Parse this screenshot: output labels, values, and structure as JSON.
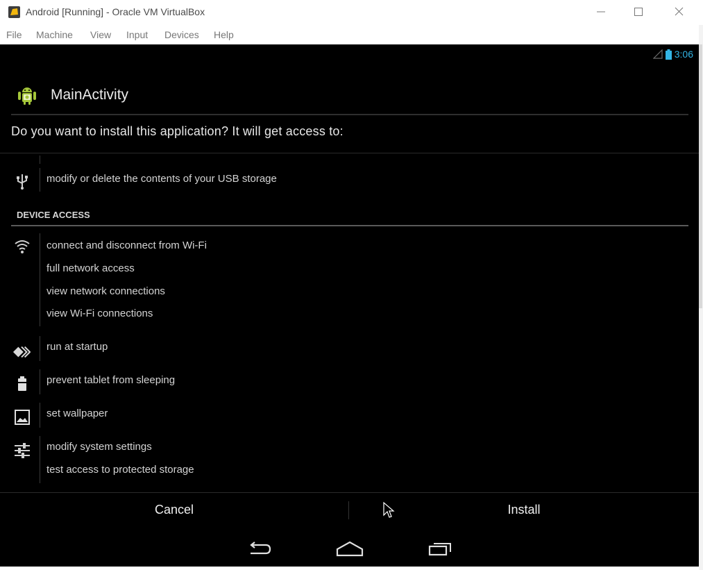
{
  "window": {
    "title": "Android [Running] - Oracle VM VirtualBox",
    "menu": [
      "File",
      "Machine",
      "View",
      "Input",
      "Devices",
      "Help"
    ],
    "app_icon": "virtualbox-icon",
    "controls": [
      "minimize-icon",
      "maximize-icon",
      "close-icon"
    ]
  },
  "android": {
    "status_bar": {
      "time": "3:06",
      "icons": [
        "signal-icon",
        "battery-icon"
      ]
    },
    "app": {
      "name": "MainActivity",
      "icon": "android-robot-icon"
    },
    "prompt": "Do you want to install this application? It will get access to:",
    "storage_permissions": [
      {
        "icon": "usb-icon",
        "items": [
          "modify or delete the contents of your USB storage"
        ]
      }
    ],
    "section_title": "DEVICE ACCESS",
    "device_permissions": [
      {
        "icon": "wifi-icon",
        "items": [
          "connect and disconnect from Wi-Fi",
          "full network access",
          "view network connections",
          "view Wi-Fi connections"
        ]
      },
      {
        "icon": "startup-icon",
        "items": [
          "run at startup"
        ]
      },
      {
        "icon": "battery-lock-icon",
        "items": [
          "prevent tablet from sleeping"
        ]
      },
      {
        "icon": "wallpaper-icon",
        "items": [
          "set wallpaper"
        ]
      },
      {
        "icon": "settings-sliders-icon",
        "items": [
          "modify system settings",
          "test access to protected storage"
        ]
      }
    ],
    "buttons": {
      "cancel": "Cancel",
      "install": "Install"
    },
    "nav": [
      "back-icon",
      "home-icon",
      "recent-apps-icon"
    ],
    "accent_color": "#33b5e5"
  }
}
